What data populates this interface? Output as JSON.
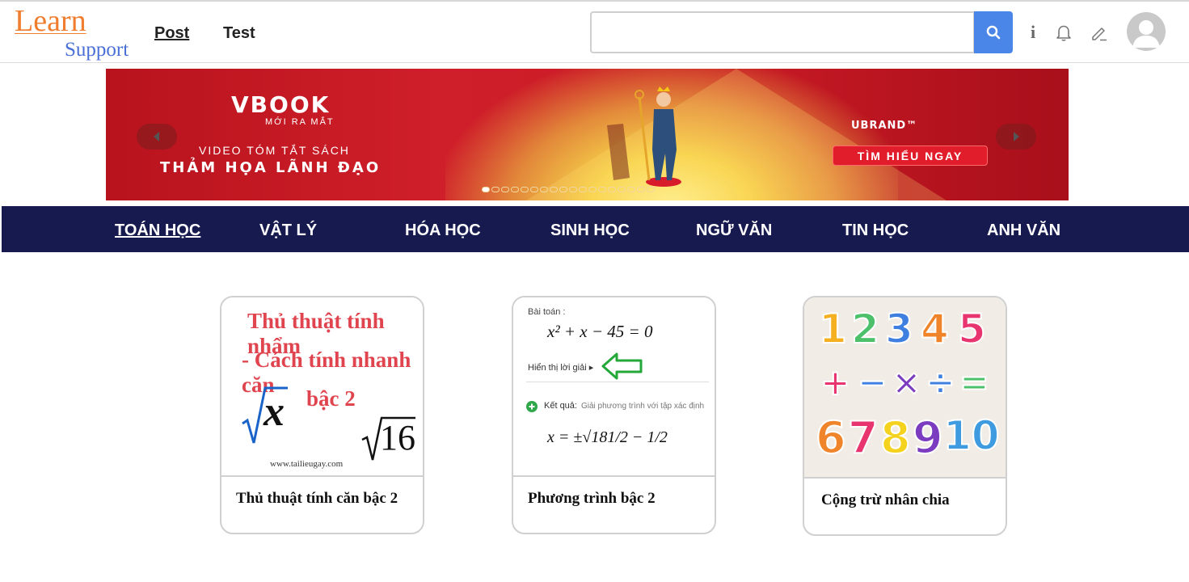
{
  "header": {
    "logo_learn": "Learn",
    "logo_support": "Support",
    "nav": [
      {
        "label": "Post"
      },
      {
        "label": "Test"
      }
    ],
    "search_placeholder": "",
    "icons": {
      "search": "search-icon",
      "info": "info-icon",
      "bell": "bell-icon",
      "edit": "pencil-icon",
      "avatar": "user-avatar-icon"
    }
  },
  "banner": {
    "brand": "VBOOK",
    "tagline": "MỚI RA MẮT",
    "line1": "VIDEO TÓM TẮT SÁCH",
    "line2": "THẢM HỌA LÃNH ĐẠO",
    "partner": "UBRAND™",
    "cta": "TÌM HIỂU NGAY",
    "prev_icon": "chevron-left-icon",
    "next_icon": "chevron-right-icon",
    "slide_count": 18,
    "active_slide": 1
  },
  "subjects": [
    {
      "label": "TOÁN HỌC",
      "active": true
    },
    {
      "label": "VẬT LÝ",
      "active": false
    },
    {
      "label": "HÓA HỌC",
      "active": false
    },
    {
      "label": "SINH HỌC",
      "active": false
    },
    {
      "label": "NGỮ VĂN",
      "active": false
    },
    {
      "label": "TIN HỌC",
      "active": false
    },
    {
      "label": "ANH VĂN",
      "active": false
    }
  ],
  "cards": [
    {
      "title": "Thủ thuật tính căn bậc 2",
      "image": {
        "line1": "Thủ thuật tính nhẩm",
        "line2": "- Cách tính nhanh căn",
        "line3": "bậc 2",
        "sqrt_x": "x",
        "sqrt_16": "16",
        "watermark": "www.tailieugay.com"
      }
    },
    {
      "title": "Phương trình bậc 2",
      "image": {
        "label_problem": "Bài toán :",
        "equation": "x² + x − 45 = 0",
        "show_solution": "Hiển thị lời giải ▸",
        "result_label": "Kết quả:",
        "result_desc": "Giải phương trình với tập xác định",
        "solution": "x = ±√181/2 − 1/2"
      }
    },
    {
      "title": "Cộng trừ nhân chia",
      "image": {
        "digits_row1": [
          "1",
          "2",
          "3",
          "4",
          "5"
        ],
        "operators": [
          "+",
          "−",
          "×",
          "÷",
          "="
        ],
        "digits_row2": [
          "6",
          "7",
          "8",
          "9",
          "10"
        ]
      }
    }
  ],
  "colors": {
    "nav_bg": "#171a4f",
    "logo_learn": "#f07d2e",
    "logo_support": "#4a6fd6",
    "search_btn": "#4a86e8",
    "banner_red": "#c81a25"
  }
}
